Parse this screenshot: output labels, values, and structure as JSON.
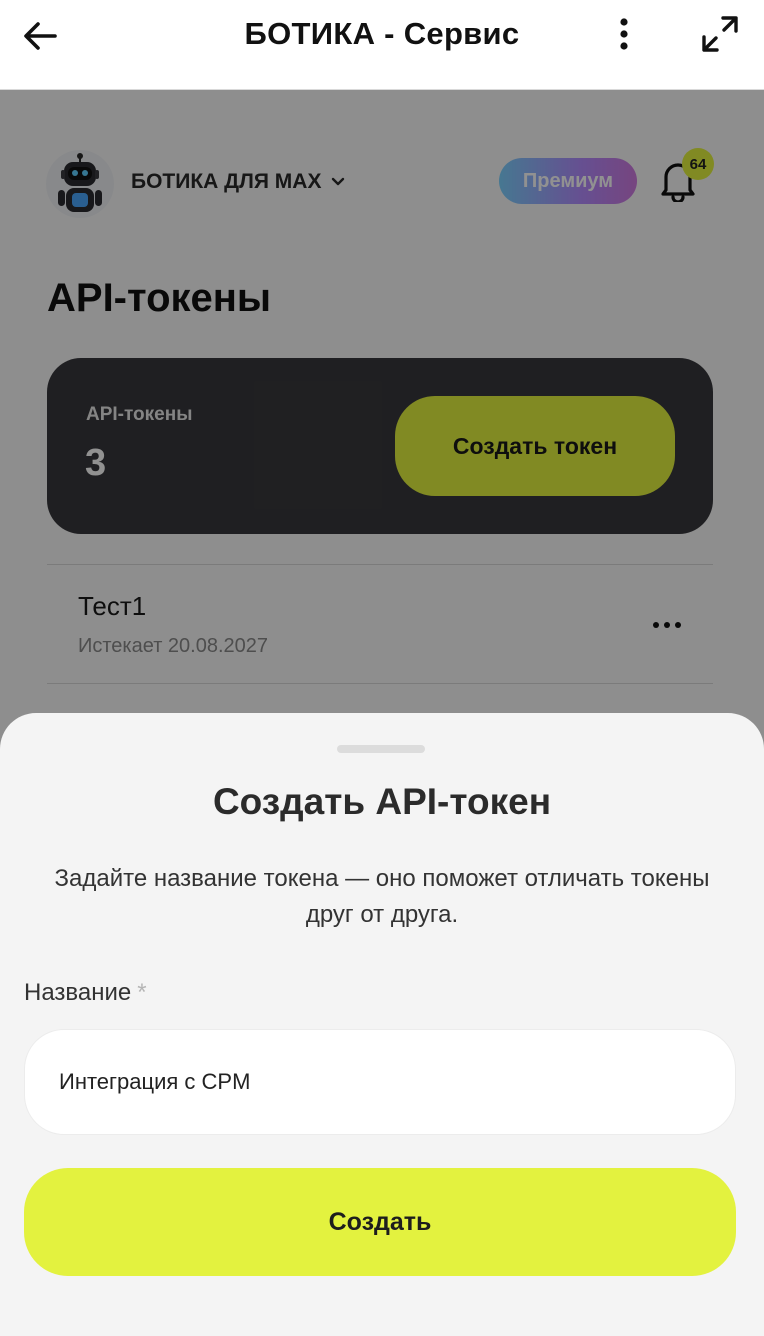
{
  "app_bar": {
    "title": "БОТИКА - Сервис",
    "back_icon": "arrow-left-icon",
    "more_icon": "vertical-dots-icon",
    "expand_icon": "expand-arrows-icon"
  },
  "header": {
    "bot_name": "БОТИКА ДЛЯ MAX",
    "premium_label": "Премиум",
    "notifications_count": "64"
  },
  "page": {
    "title": "API-токены"
  },
  "stats": {
    "label": "API-токены",
    "value": "3",
    "create_button": "Создать токен"
  },
  "tokens": [
    {
      "name": "Тест1",
      "expires": "Истекает 20.08.2027"
    }
  ],
  "dialog": {
    "title": "Создать API-токен",
    "description": "Задайте название токена — оно поможет отличать токены друг от друга.",
    "name_label": "Название",
    "required_mark": "*",
    "name_value": "Интеграция с CPM",
    "submit_label": "Создать"
  },
  "colors": {
    "accent": "#e3f23f",
    "card_dark": "#38383c",
    "sheet_bg": "#f4f4f4"
  }
}
